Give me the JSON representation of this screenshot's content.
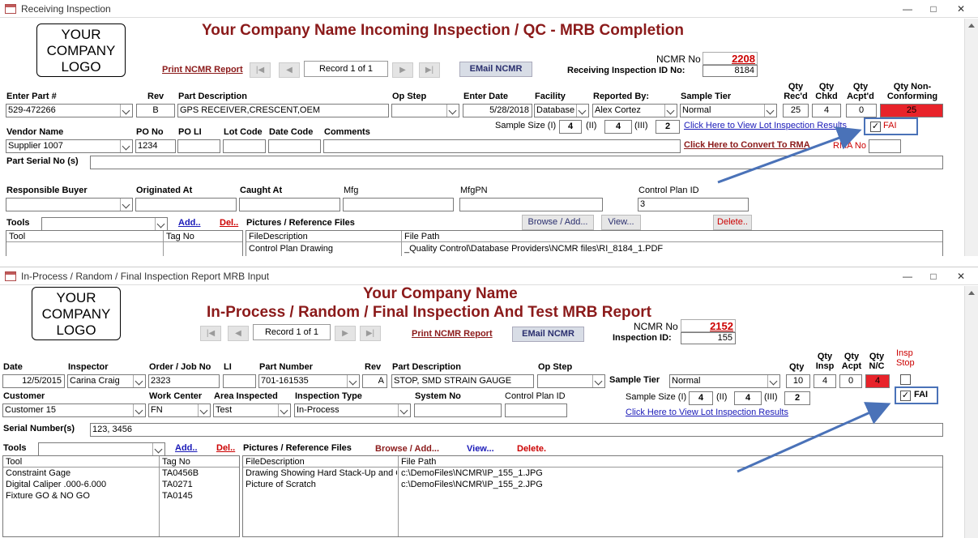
{
  "top": {
    "window_title": "Receiving Inspection",
    "logo": [
      "YOUR",
      "COMPANY",
      "LOGO"
    ],
    "heading": "Your Company Name Incoming Inspection / QC - MRB Completion",
    "print_link": "Print NCMR Report",
    "record": "Record 1 of 1",
    "email_button": "EMail NCMR",
    "ncmr_label": "NCMR No",
    "ncmr_value": "2208",
    "ri_label": "Receiving Inspection ID No:",
    "ri_value": "8184",
    "labels": {
      "part": "Enter Part #",
      "rev": "Rev",
      "desc": "Part Description",
      "op": "Op Step",
      "date": "Enter Date",
      "facility": "Facility",
      "reported": "Reported By:",
      "tier": "Sample Tier",
      "qty_recd": "Qty Rec'd",
      "qty_chkd": "Qty Chkd",
      "qty_acpt": "Qty Acpt'd",
      "qty_nc": "Qty Non-Conforming",
      "vendor": "Vendor Name",
      "po": "PO No",
      "poli": "PO LI",
      "lot": "Lot Code",
      "datecode": "Date Code",
      "comments": "Comments",
      "serial": "Part Serial No (s)",
      "buyer": "Responsible Buyer",
      "orig": "Originated At",
      "caught": "Caught At",
      "mfg": "Mfg",
      "mfgpn": "MfgPN",
      "control": "Control Plan ID",
      "tools": "Tools",
      "pictures": "Pictures / Reference Files",
      "rma": "RMA No",
      "sample_size": "Sample Size (I)",
      "ii": "(II)",
      "iii": "(III)",
      "fai": "FAI"
    },
    "values": {
      "part": "529-472266",
      "rev": "B",
      "desc": "GPS RECEIVER,CRESCENT,OEM",
      "op": "",
      "date": "5/28/2018",
      "facility": "Database",
      "reported": "Alex Cortez",
      "tier": "Normal",
      "qty_recd": "25",
      "qty_chkd": "4",
      "qty_acpt": "0",
      "qty_nc": "25",
      "vendor": "Supplier 1007",
      "po": "1234",
      "control": "3",
      "ss1": "4",
      "ss2": "4",
      "ss3": "2"
    },
    "links": {
      "lot_results": "Click Here to View Lot Inspection Results",
      "rma": "Click Here to Convert To RMA",
      "add": "Add..",
      "del": "Del.."
    },
    "buttons": {
      "browse": "Browse / Add...",
      "view": "View...",
      "delete": "Delete.."
    },
    "tool_grid": {
      "headers": [
        "Tool",
        "Tag No"
      ]
    },
    "file_grid": {
      "headers": [
        "FileDescription",
        "File Path"
      ],
      "rows": [
        [
          "Control Plan Drawing",
          "_Quality Control\\Database Providers\\NCMR files\\RI_8184_1.PDF"
        ]
      ]
    }
  },
  "bottom": {
    "window_title": "In-Process / Random / Final Inspection Report MRB Input",
    "logo": [
      "YOUR",
      "COMPANY",
      "LOGO"
    ],
    "heading1": "Your Company Name",
    "heading2": "In-Process / Random / Final Inspection And Test MRB Report",
    "print_link": "Print NCMR Report",
    "record": "Record 1 of 1",
    "email_button": "EMail NCMR",
    "ncmr_label": "NCMR No",
    "ncmr_value": "2152",
    "insp_label": "Inspection ID:",
    "insp_value": "155",
    "labels": {
      "date": "Date",
      "inspector": "Inspector",
      "order": "Order / Job No",
      "li": "LI",
      "part": "Part Number",
      "rev": "Rev",
      "desc": "Part Description",
      "op": "Op Step",
      "tier": "Sample Tier",
      "qty": "Qty",
      "qty_insp": "Qty Insp",
      "qty_acpt": "Qty Acpt",
      "qty_nc": "Qty N/C",
      "insp_stop": "Insp Stop",
      "customer": "Customer",
      "work_center": "Work Center",
      "area": "Area Inspected",
      "type": "Inspection Type",
      "system": "System No",
      "control": "Control Plan ID",
      "sample_size": "Sample Size (I)",
      "ii": "(II)",
      "iii": "(III)",
      "fai": "FAI",
      "serial": "Serial Number(s)",
      "tools": "Tools",
      "pictures": "Pictures / Reference Files"
    },
    "values": {
      "date": "12/5/2015",
      "inspector": "Carina Craig",
      "order": "2323",
      "li": "",
      "part": "701-161535",
      "rev": "A",
      "desc": "STOP, SMD STRAIN GAUGE",
      "tier": "Normal",
      "qty": "10",
      "qty_insp": "4",
      "qty_acpt": "0",
      "qty_nc": "4",
      "customer": "Customer 15",
      "work_center": "FN",
      "area": "Test",
      "type": "In-Process",
      "ss1": "4",
      "ss2": "4",
      "ss3": "2",
      "serial": "123, 3456"
    },
    "links": {
      "lot_results": "Click Here to View Lot Inspection Results",
      "add": "Add..",
      "del": "Del..",
      "browse": "Browse / Add...",
      "view": "View...",
      "delete": "Delete."
    },
    "tool_grid": {
      "headers": [
        "Tool",
        "Tag No"
      ],
      "rows": [
        [
          "Constraint Gage",
          "TA0456B"
        ],
        [
          "Digital Caliper .000-6.000",
          "TA0271"
        ],
        [
          "Fixture GO & NO GO",
          "TA0145"
        ]
      ]
    },
    "file_grid": {
      "headers": [
        "FileDescription",
        "File Path"
      ],
      "rows": [
        [
          "Drawing Showing Hard Stack-Up and Or",
          "c:\\DemoFiles\\NCMR\\IP_155_1.JPG"
        ],
        [
          "Picture of Scratch",
          "c:\\DemoFiles\\NCMR\\IP_155_2.JPG"
        ]
      ]
    }
  },
  "colors": {
    "heading": "#8b1a1a",
    "nonconforming": "#e8232a",
    "link": "#1a1ab8",
    "highlight": "#4a72b8"
  }
}
